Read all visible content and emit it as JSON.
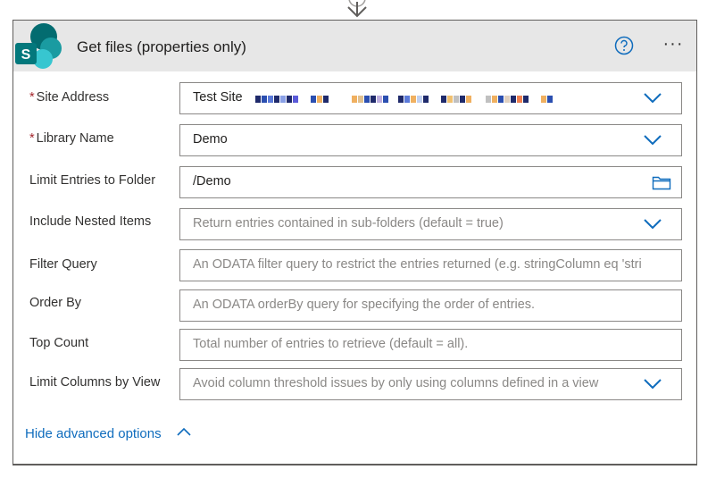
{
  "action": {
    "title": "Get files (properties only)",
    "icons": {
      "logo": "sharepoint-logo-icon",
      "help": "help-circle-icon",
      "more": "more-options-icon"
    },
    "more_label": "···"
  },
  "fields": [
    {
      "label": "Site Address",
      "required": true,
      "value": "Test Site",
      "placeholder": "",
      "control": "dropdown",
      "redacted": true
    },
    {
      "label": "Library Name",
      "required": true,
      "value": "Demo",
      "placeholder": "",
      "control": "dropdown"
    },
    {
      "label": "Limit Entries to Folder",
      "required": false,
      "value": "/Demo",
      "placeholder": "",
      "control": "folder-picker"
    },
    {
      "label": "Include Nested Items",
      "required": false,
      "value": "",
      "placeholder": "Return entries contained in sub-folders (default = true)",
      "control": "dropdown"
    },
    {
      "label": "Filter Query",
      "required": false,
      "value": "",
      "placeholder": "An ODATA filter query to restrict the entries returned (e.g. stringColumn eq 'stri",
      "control": "text"
    },
    {
      "label": "Order By",
      "required": false,
      "value": "",
      "placeholder": "An ODATA orderBy query for specifying the order of entries.",
      "control": "text"
    },
    {
      "label": "Top Count",
      "required": false,
      "value": "",
      "placeholder": "Total number of entries to retrieve (default = all).",
      "control": "text"
    },
    {
      "label": "Limit Columns by View",
      "required": false,
      "value": "",
      "placeholder": "Avoid column threshold issues by only using columns defined in a view",
      "control": "dropdown"
    }
  ],
  "required_marker": "*",
  "advanced_toggle": "Hide advanced options",
  "colors": {
    "accent": "#0f6cbd",
    "required": "#a4262c",
    "header_bg": "#e7e7e7"
  }
}
